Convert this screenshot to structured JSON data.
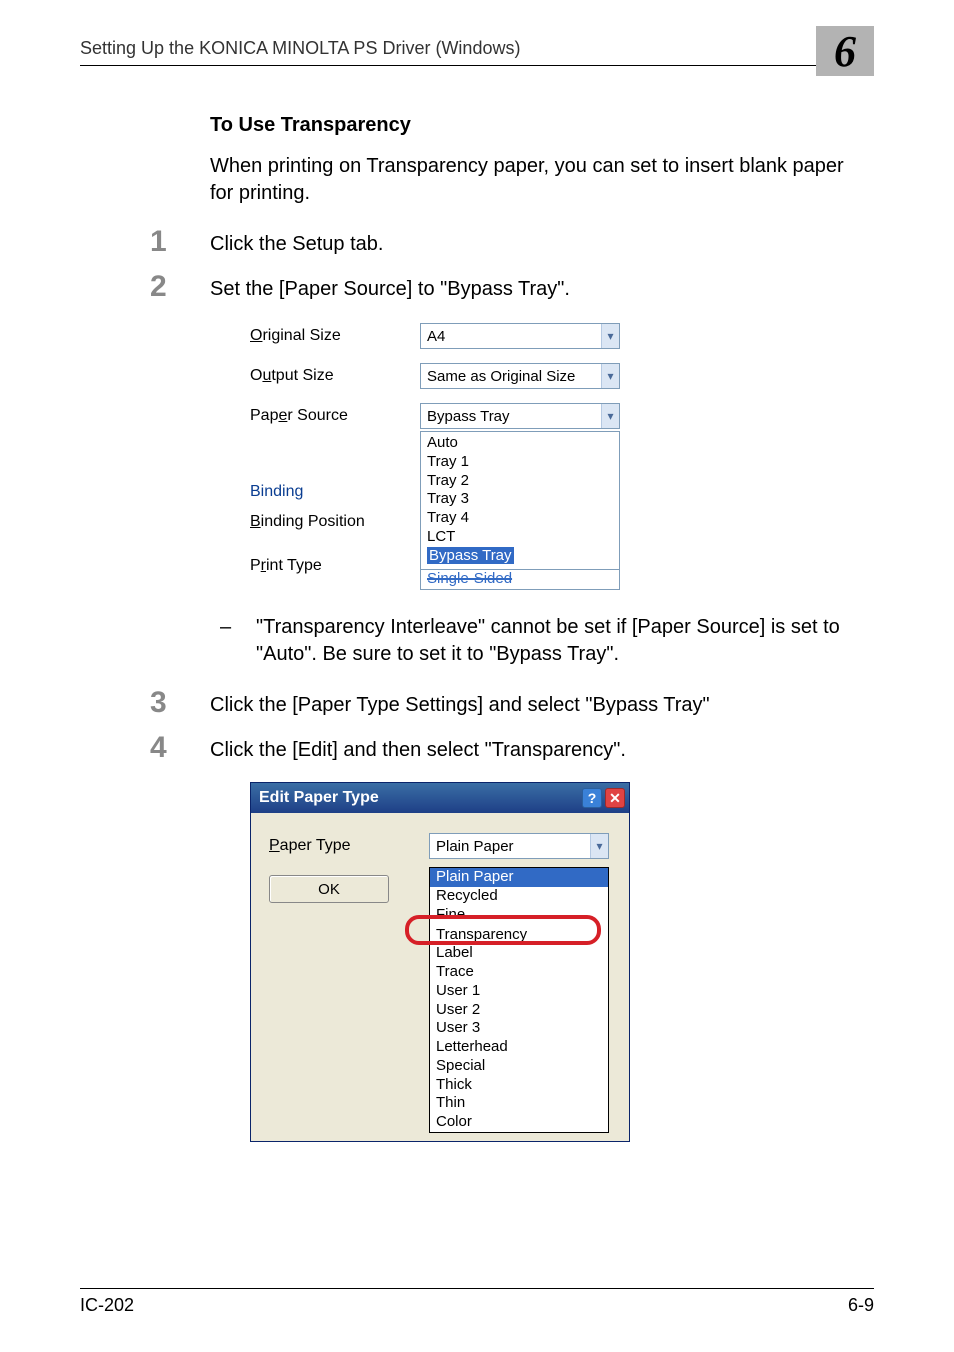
{
  "header": {
    "title": "Setting Up the KONICA MINOLTA PS Driver (Windows)",
    "chapter": "6"
  },
  "section": {
    "heading": "To Use Transparency",
    "intro": "When printing on Transparency paper, you can set to insert blank paper for printing."
  },
  "steps": {
    "s1_num": "1",
    "s1_text": "Click the Setup tab.",
    "s2_num": "2",
    "s2_text": "Set the [Paper Source] to \"Bypass Tray\".",
    "s2_note_dash": "–",
    "s2_note": "\"Transparency Interleave\" cannot be set if [Paper Source] is set to \"Auto\". Be sure to set it to \"Bypass Tray\".",
    "s3_num": "3",
    "s3_text": "Click the [Paper Type Settings] and select \"Bypass Tray\"",
    "s4_num": "4",
    "s4_text": "Click the [Edit] and then select \"Transparency\"."
  },
  "fig1": {
    "original_size_label": "Original Size",
    "original_size_value": "A4",
    "output_size_label": "Output Size",
    "output_size_value": "Same as Original Size",
    "paper_source_label": "Paper Source",
    "paper_source_value": "Bypass Tray",
    "binding_label": "Binding",
    "binding_position_label": "Binding Position",
    "print_type_label": "Print Type",
    "options": {
      "o1": "Auto",
      "o2": "Tray 1",
      "o3": "Tray 2",
      "o4": "Tray 3",
      "o5": "Tray 4",
      "o6": "LCT",
      "o7": "Bypass Tray",
      "o8": "Single-Sided"
    }
  },
  "fig2": {
    "title": "Edit Paper Type",
    "help_glyph": "?",
    "close_glyph": "✕",
    "paper_type_label": "Paper Type",
    "paper_type_value": "Plain Paper",
    "ok_label": "OK",
    "options": {
      "o1": "Plain Paper",
      "o2": "Recycled",
      "o3": "Fine",
      "o4": "Transparency",
      "o5": "Label",
      "o6": "Trace",
      "o7": "User 1",
      "o8": "User 2",
      "o9": "User 3",
      "o10": "Letterhead",
      "o11": "Special",
      "o12": "Thick",
      "o13": "Thin",
      "o14": "Color"
    }
  },
  "footer": {
    "left": "IC-202",
    "right": "6-9"
  }
}
